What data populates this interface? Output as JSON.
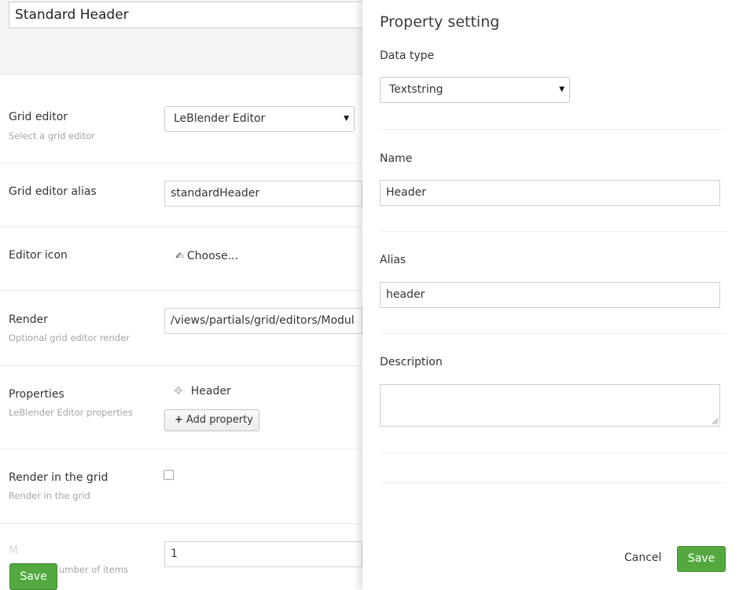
{
  "editor": {
    "name_value": "Standard Header",
    "grid_editor": {
      "label": "Grid editor",
      "description": "Select a grid editor",
      "selected": "LeBlender Editor"
    },
    "grid_editor_alias": {
      "label": "Grid editor alias",
      "value": "standardHeader"
    },
    "editor_icon": {
      "label": "Editor icon",
      "choose_label": "Choose..."
    },
    "render": {
      "label": "Render",
      "description": "Optional grid editor render",
      "value": "/views/partials/grid/editors/Modul"
    },
    "properties": {
      "label": "Properties",
      "description": "LeBlender Editor properties",
      "items": [
        "Header"
      ],
      "add_label": "Add property"
    },
    "render_in_grid": {
      "label": "Render in the grid",
      "description": "Render in the grid",
      "checked": false
    },
    "max_items": {
      "label_fragment": "M",
      "description_fragment": "umber of items",
      "value": "1"
    },
    "save_label": "Save"
  },
  "panel": {
    "title": "Property setting",
    "data_type": {
      "label": "Data type",
      "selected": "Textstring"
    },
    "name": {
      "label": "Name",
      "value": "Header"
    },
    "alias": {
      "label": "Alias",
      "value": "header"
    },
    "description": {
      "label": "Description",
      "value": ""
    },
    "cancel_label": "Cancel",
    "save_label": "Save"
  },
  "colors": {
    "save_green": "#53a93f",
    "muted_text": "#a4a4a4",
    "header_band": "#f5f5f5"
  },
  "icons": {
    "editor_icon_choose": "pencil-edit-icon",
    "property_move": "move-arrows-icon",
    "add_property": "plus-icon",
    "select_caret": "caret-down-icon"
  }
}
